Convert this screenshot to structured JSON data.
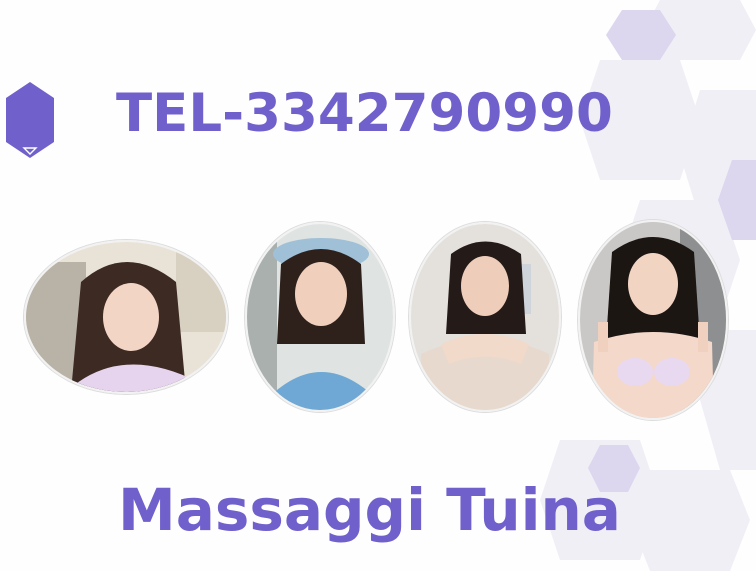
{
  "phone": "TEL-3342790990",
  "title": "Massaggi Tuina",
  "photos": [
    {
      "icon": "portrait-photo-1"
    },
    {
      "icon": "portrait-photo-2"
    },
    {
      "icon": "portrait-photo-3"
    },
    {
      "icon": "portrait-photo-4"
    }
  ],
  "colors": {
    "accent": "#7060cc",
    "hex_light": "#efedf5",
    "hex_mid": "#d6d0ec",
    "background": "#fefefe"
  }
}
